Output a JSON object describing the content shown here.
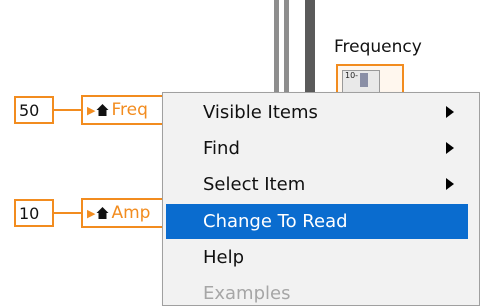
{
  "block_diagram": {
    "constant_top": "50",
    "constant_bottom": "10",
    "property_node_top": "Freq",
    "property_node_bottom": "Amp",
    "terminal_label": "Frequency",
    "terminal_readout": "10-"
  },
  "context_menu": {
    "items": [
      {
        "label": "Visible Items",
        "has_submenu": true,
        "state": "normal"
      },
      {
        "label": "Find",
        "has_submenu": true,
        "state": "normal"
      },
      {
        "label": "Select Item",
        "has_submenu": true,
        "state": "normal"
      },
      {
        "label": "Change To Read",
        "has_submenu": false,
        "state": "highlighted"
      },
      {
        "label": "Help",
        "has_submenu": false,
        "state": "normal"
      },
      {
        "label": "Examples",
        "has_submenu": false,
        "state": "disabled"
      }
    ]
  },
  "colors": {
    "wire_orange": "#f28c1f",
    "menu_highlight": "#0a6ccf",
    "menu_background": "#f2f2f2",
    "disabled_text": "#a6a6a6"
  }
}
